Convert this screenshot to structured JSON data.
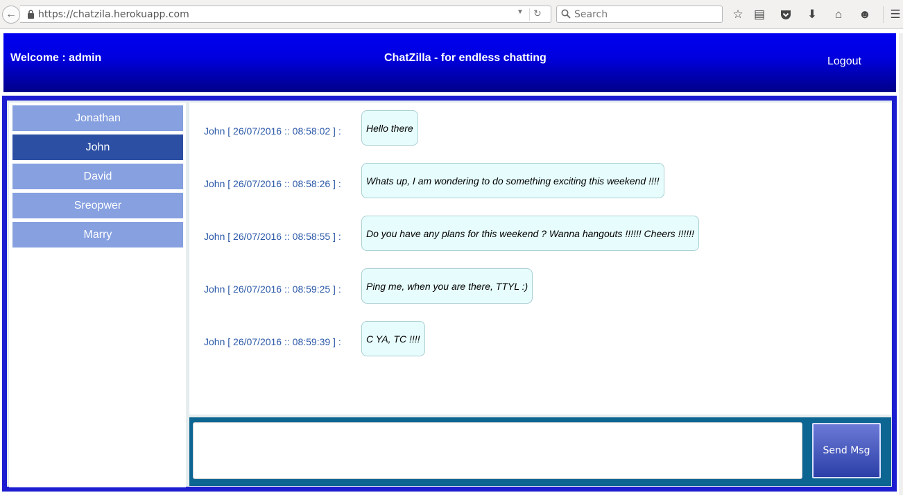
{
  "browser": {
    "url": "https://chatzila.herokuapp.com",
    "search_placeholder": "Search"
  },
  "header": {
    "welcome": "Welcome : admin",
    "title": "ChatZilla - for endless chatting",
    "logout": "Logout"
  },
  "sidebar": {
    "users": [
      "Jonathan",
      "John",
      "David",
      "Sreopwer",
      "Marry"
    ],
    "active": "John"
  },
  "messages": [
    {
      "meta": "John [ 26/07/2016 :: 08:58:02 ] :",
      "text": "Hello there"
    },
    {
      "meta": "John [ 26/07/2016 :: 08:58:26 ] :",
      "text": "Whats up, I am wondering to do something exciting this weekend !!!!"
    },
    {
      "meta": "John [ 26/07/2016 :: 08:58:55 ] :",
      "text": "Do you have any plans for this weekend ? Wanna hangouts !!!!!! Cheers !!!!!!"
    },
    {
      "meta": "John [ 26/07/2016 :: 08:59:25 ] :",
      "text": "Ping me, when you are there, TTYL :)"
    },
    {
      "meta": "John [ 26/07/2016 :: 08:59:39 ] :",
      "text": "C YA, TC !!!!"
    }
  ],
  "compose": {
    "value": "",
    "send_label": "Send Msg"
  },
  "colors": {
    "header_top": "#0000f0",
    "header_bottom": "#000088",
    "frame": "#1c1cd0",
    "user_item": "#86a0e0",
    "user_item_active": "#2c4fa4",
    "bubble": "#e7fcfc",
    "meta_text": "#2b59a8",
    "compose_bar": "#0d6592"
  }
}
